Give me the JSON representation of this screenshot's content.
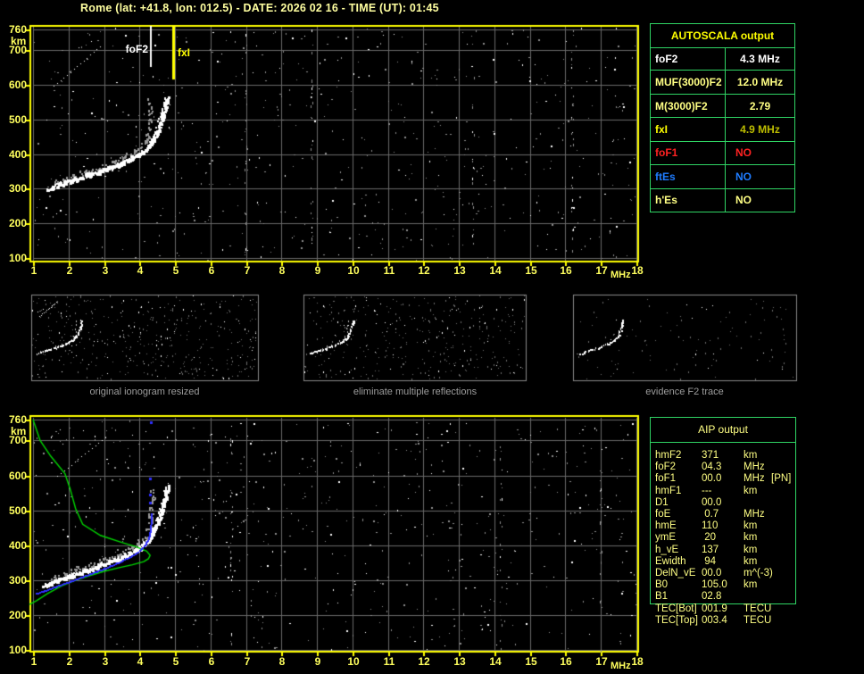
{
  "title": "Rome (lat: +41.8, lon: 012.5) - DATE: 2026 02 16 - TIME (UT): 01:45",
  "colors": {
    "background": "#000000",
    "frame": "#ffff00",
    "grid": "#6a6a6a",
    "noise": "#8f8f8f",
    "trace_white": "#ffffff",
    "trace_gray": "#9a9a9a",
    "profile_green": "#00d600",
    "fitted_blue": "#2f2fff",
    "table_border": "#2fd464",
    "pale_yellow": "#ffff84",
    "bright_yellow": "#ffff00",
    "olive_yellow": "#bdbd00",
    "red": "#ff2222",
    "blue": "#1f7cff",
    "caption_gray": "#9c9c9c"
  },
  "axis": {
    "x_ticks": [
      "1",
      "2",
      "3",
      "4",
      "5",
      "6",
      "7",
      "8",
      "9",
      "10",
      "11",
      "12",
      "13",
      "14",
      "15",
      "16",
      "17",
      "18"
    ],
    "x_unit": "MHz",
    "y_ticks": [
      "760",
      "700",
      "600",
      "500",
      "400",
      "300",
      "200",
      "100"
    ],
    "y_unit": "km"
  },
  "top_ionogram": {
    "markers": [
      {
        "label": "foF2",
        "freq": 4.32,
        "color": "#ffffff"
      },
      {
        "label": "fxI",
        "freq": 4.95,
        "color": "#ffff00"
      }
    ]
  },
  "panels": [
    {
      "caption": "original ionogram resized"
    },
    {
      "caption": "eliminate multiple reflections"
    },
    {
      "caption": "evidence F2 trace"
    }
  ],
  "autoscala_table": {
    "header": "AUTOSCALA output",
    "rows": [
      {
        "label": "foF2",
        "value": "4.3 MHz",
        "color": "#ffffff"
      },
      {
        "label": "MUF(3000)F2",
        "value": "12.0 MHz",
        "color": "#ffff84"
      },
      {
        "label": "M(3000)F2",
        "value": "2.79",
        "color": "#ffff84"
      },
      {
        "label": "fxI",
        "value": "4.9 MHz",
        "color": "#ffff00",
        "value_color": "#bdbd00"
      },
      {
        "label": "foF1",
        "value": "NO",
        "color": "#ff2222"
      },
      {
        "label": "ftEs",
        "value": "NO",
        "color": "#1f7cff"
      },
      {
        "label": "h'Es",
        "value": "NO",
        "color": "#ffff84"
      }
    ]
  },
  "aip_table": {
    "header": "AIP output",
    "rows": [
      {
        "label": "hmF2",
        "value": "371",
        "unit": "km",
        "note": ""
      },
      {
        "label": "foF2",
        "value": "04.3",
        "unit": "MHz",
        "note": ""
      },
      {
        "label": "foF1",
        "value": "00.0",
        "unit": "MHz",
        "note": "[PN]"
      },
      {
        "label": "hmF1",
        "value": "---",
        "unit": "km",
        "note": ""
      },
      {
        "label": "D1",
        "value": "00.0",
        "unit": "",
        "note": ""
      },
      {
        "label": "foE",
        "value": " 0.7",
        "unit": "MHz",
        "note": ""
      },
      {
        "label": "hmE",
        "value": "110",
        "unit": "km",
        "note": ""
      },
      {
        "label": "ymE",
        "value": " 20",
        "unit": "km",
        "note": ""
      },
      {
        "label": "h_vE",
        "value": "137",
        "unit": "km",
        "note": ""
      },
      {
        "label": "Ewidth",
        "value": " 94",
        "unit": "km",
        "note": ""
      },
      {
        "label": "DelN_vE",
        "value": "00.0",
        "unit": "m^(-3)",
        "note": ""
      },
      {
        "label": "B0",
        "value": "105.0",
        "unit": "km",
        "note": ""
      },
      {
        "label": "B1",
        "value": "02.8",
        "unit": "",
        "note": ""
      },
      {
        "label": "TEC[Bot]",
        "value": "001.9",
        "unit": "TECU",
        "note": ""
      },
      {
        "label": "TEC[Top]",
        "value": "003.4",
        "unit": "TECU",
        "note": ""
      }
    ]
  },
  "chart_data": [
    {
      "type": "scatter",
      "title": "top ionogram (virtual height vs frequency)",
      "xlabel": "MHz",
      "ylabel": "km",
      "xlim": [
        1,
        18
      ],
      "ylim": [
        100,
        760
      ],
      "grid": true,
      "series": [
        {
          "name": "F2 trace main",
          "points": [
            [
              1.45,
              300
            ],
            [
              1.8,
              315
            ],
            [
              2.2,
              328
            ],
            [
              2.6,
              341
            ],
            [
              3.0,
              355
            ],
            [
              3.4,
              370
            ],
            [
              3.7,
              383
            ],
            [
              3.95,
              397
            ],
            [
              4.15,
              412
            ],
            [
              4.3,
              428
            ],
            [
              4.42,
              448
            ],
            [
              4.52,
              472
            ],
            [
              4.62,
              500
            ],
            [
              4.7,
              528
            ],
            [
              4.76,
              552
            ],
            [
              4.79,
              566
            ]
          ]
        },
        {
          "name": "F2 trace secondary mode",
          "points": [
            [
              1.6,
              318
            ],
            [
              2.0,
              332
            ],
            [
              2.4,
              346
            ],
            [
              2.8,
              359
            ],
            [
              3.2,
              373
            ],
            [
              3.5,
              386
            ],
            [
              3.75,
              399
            ],
            [
              3.95,
              412
            ],
            [
              4.1,
              426
            ],
            [
              4.2,
              444
            ],
            [
              4.26,
              470
            ],
            [
              4.29,
              500
            ],
            [
              4.31,
              530
            ],
            [
              4.32,
              558
            ]
          ]
        },
        {
          "name": "multiple reflection streak",
          "points": [
            [
              1.6,
              595
            ],
            [
              2.9,
              710
            ]
          ]
        }
      ],
      "markers": [
        {
          "label": "foF2",
          "x": 4.32
        },
        {
          "label": "fxI",
          "x": 4.95
        }
      ]
    },
    {
      "type": "scatter",
      "title": "bottom ionogram with AIP inversion",
      "xlabel": "MHz",
      "ylabel": "km",
      "xlim": [
        1,
        18
      ],
      "ylim": [
        100,
        760
      ],
      "grid": true,
      "series": [
        {
          "name": "F2 trace main",
          "points": [
            [
              1.3,
              285
            ],
            [
              1.7,
              300
            ],
            [
              2.1,
              314
            ],
            [
              2.5,
              328
            ],
            [
              2.9,
              343
            ],
            [
              3.3,
              359
            ],
            [
              3.65,
              374
            ],
            [
              3.95,
              390
            ],
            [
              4.15,
              406
            ],
            [
              4.3,
              424
            ],
            [
              4.42,
              446
            ],
            [
              4.52,
              472
            ],
            [
              4.62,
              502
            ],
            [
              4.7,
              530
            ],
            [
              4.76,
              554
            ],
            [
              4.79,
              568
            ]
          ]
        },
        {
          "name": "F2 trace secondary mode",
          "points": [
            [
              1.5,
              305
            ],
            [
              1.9,
              320
            ],
            [
              2.3,
              334
            ],
            [
              2.7,
              348
            ],
            [
              3.1,
              362
            ],
            [
              3.45,
              376
            ],
            [
              3.75,
              391
            ],
            [
              4.0,
              406
            ],
            [
              4.15,
              421
            ],
            [
              4.25,
              440
            ],
            [
              4.3,
              466
            ],
            [
              4.33,
              496
            ],
            [
              4.35,
              528
            ],
            [
              4.36,
              558
            ]
          ]
        },
        {
          "name": "fitted trace (blue)",
          "points": [
            [
              1.1,
              262
            ],
            [
              1.5,
              276
            ],
            [
              1.9,
              291
            ],
            [
              2.3,
              306
            ],
            [
              2.7,
              321
            ],
            [
              3.1,
              337
            ],
            [
              3.45,
              352
            ],
            [
              3.75,
              368
            ],
            [
              4.0,
              384
            ],
            [
              4.15,
              400
            ],
            [
              4.25,
              418
            ],
            [
              4.3,
              440
            ],
            [
              4.32,
              462
            ],
            [
              4.33,
              489
            ]
          ]
        },
        {
          "name": "fitted trace extra points (blue)",
          "points": [
            [
              4.3,
              520
            ],
            [
              4.31,
              545
            ],
            [
              4.3,
              589
            ],
            [
              4.34,
              752
            ]
          ]
        },
        {
          "name": "electron density profile (green)",
          "points": [
            [
              1.0,
              760
            ],
            [
              1.2,
              700
            ],
            [
              1.5,
              655
            ],
            [
              1.9,
              605
            ],
            [
              2.05,
              560
            ],
            [
              2.2,
              505
            ],
            [
              2.4,
              460
            ],
            [
              2.9,
              428
            ],
            [
              3.5,
              408
            ],
            [
              3.9,
              396
            ],
            [
              4.2,
              383
            ],
            [
              4.3,
              371
            ],
            [
              4.25,
              361
            ],
            [
              4.12,
              353
            ],
            [
              3.8,
              344
            ],
            [
              3.4,
              335
            ],
            [
              3.0,
              325
            ],
            [
              2.6,
              313
            ],
            [
              2.2,
              299
            ],
            [
              1.8,
              283
            ],
            [
              1.4,
              261
            ],
            [
              1.1,
              241
            ],
            [
              0.9,
              230
            ]
          ]
        },
        {
          "name": "multiple reflection streak",
          "points": [
            [
              1.7,
              598
            ],
            [
              3.05,
              708
            ]
          ]
        }
      ]
    }
  ]
}
